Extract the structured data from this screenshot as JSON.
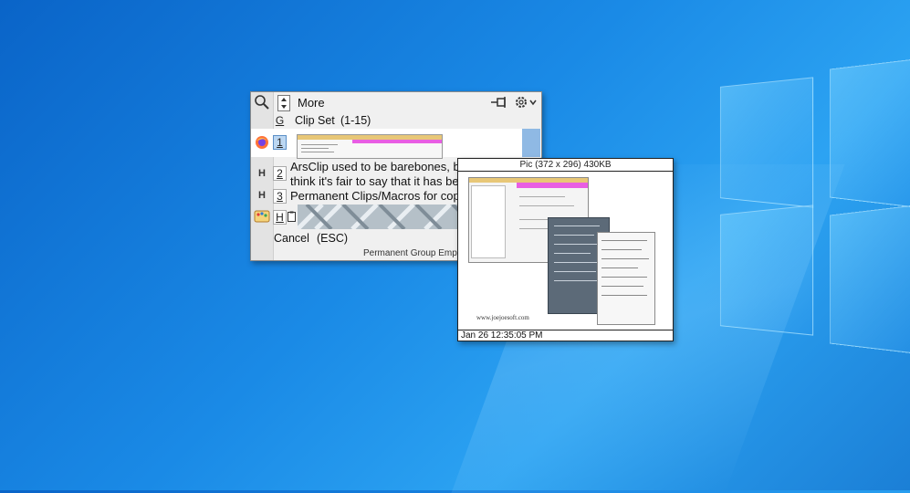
{
  "toolbar": {
    "more_label": "More"
  },
  "clipset": {
    "hotkey": "G",
    "label": "Clip Set",
    "range": "(1-15)"
  },
  "items": [
    {
      "hotkey": "1",
      "type": "image"
    },
    {
      "hotkey": "2",
      "badge": "H",
      "text": "ArsClip used to be barebones, but I think it's fair to say that it has become a nicely featured"
    },
    {
      "hotkey": "3",
      "badge": "H",
      "text": "Permanent Clips/Macros for copying"
    },
    {
      "hotkey": "H",
      "type": "image-pattern"
    }
  ],
  "cancel": {
    "label": "Cancel",
    "hint": "(ESC)"
  },
  "status": "Permanent Group Empty",
  "preview": {
    "title": "Pic (372 x 296) 430KB",
    "watermark": "www.joejoesoft.com",
    "timestamp": "Jan 26 12:35:05 PM"
  },
  "colors": {
    "selection": "#99c2e8",
    "menu_bg": "#f0f0f0",
    "desktop": "#1a8ae6"
  },
  "icons": [
    "search-icon",
    "updown-icon",
    "pin-icon",
    "gear-icon",
    "firefox-icon",
    "paint-icon",
    "clipboard-icon"
  ]
}
